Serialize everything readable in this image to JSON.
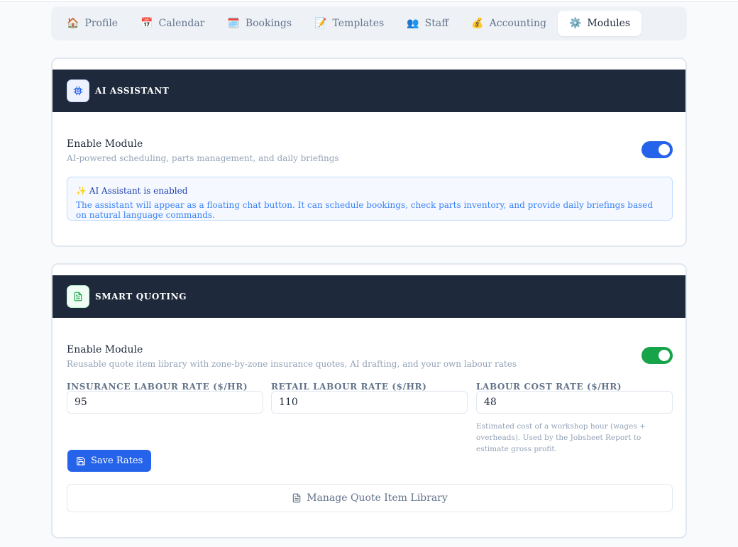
{
  "tabs": [
    {
      "icon": "🏠",
      "label": "Profile"
    },
    {
      "icon": "📅",
      "label": "Calendar"
    },
    {
      "icon": "🗓️",
      "label": "Bookings"
    },
    {
      "icon": "📝",
      "label": "Templates"
    },
    {
      "icon": "👥",
      "label": "Staff"
    },
    {
      "icon": "💰",
      "label": "Accounting"
    },
    {
      "icon": "⚙️",
      "label": "Modules"
    }
  ],
  "active_tab": "Modules",
  "ai_assistant": {
    "title": "AI ASSISTANT",
    "icon": "cpu-chip-icon",
    "enable_title": "Enable Module",
    "enable_desc": "AI-powered scheduling, parts management, and daily briefings",
    "enabled": true,
    "notice_icon": "✨",
    "notice_title": "AI Assistant is enabled",
    "notice_text": "The assistant will appear as a floating chat button. It can schedule bookings, check parts inventory, and provide daily briefings based on natural language commands."
  },
  "smart_quoting": {
    "title": "SMART QUOTING",
    "icon": "document-icon",
    "enable_title": "Enable Module",
    "enable_desc": "Reusable quote item library with zone-by-zone insurance quotes, AI drafting, and your own labour rates",
    "enabled": true,
    "fields": {
      "insurance": {
        "label": "INSURANCE LABOUR RATE ($/HR)",
        "value": "95"
      },
      "retail": {
        "label": "RETAIL LABOUR RATE ($/HR)",
        "value": "110"
      },
      "cost": {
        "label": "LABOUR COST RATE ($/HR)",
        "value": "48",
        "help": "Estimated cost of a workshop hour (wages + overheads). Used by the Jobsheet Report to estimate gross profit."
      }
    },
    "save_label": "Save Rates",
    "library_label": "Manage Quote Item Library"
  },
  "colors": {
    "primary": "#2563eb",
    "success": "#16a34a",
    "header_bg": "#1e293b"
  }
}
